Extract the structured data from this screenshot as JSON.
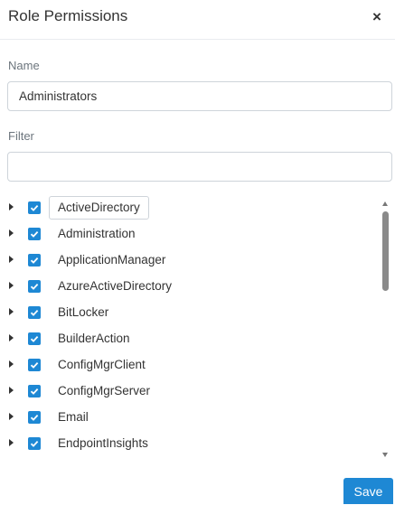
{
  "dialog": {
    "title": "Role Permissions",
    "close_icon": "close-icon",
    "close_glyph": "×"
  },
  "name_field": {
    "label": "Name",
    "value": "Administrators"
  },
  "filter_field": {
    "label": "Filter",
    "value": ""
  },
  "tree": {
    "items": [
      {
        "label": "ActiveDirectory",
        "checked": true,
        "focused": true
      },
      {
        "label": "Administration",
        "checked": true
      },
      {
        "label": "ApplicationManager",
        "checked": true
      },
      {
        "label": "AzureActiveDirectory",
        "checked": true
      },
      {
        "label": "BitLocker",
        "checked": true
      },
      {
        "label": "BuilderAction",
        "checked": true
      },
      {
        "label": "ConfigMgrClient",
        "checked": true
      },
      {
        "label": "ConfigMgrServer",
        "checked": true
      },
      {
        "label": "Email",
        "checked": true
      },
      {
        "label": "EndpointInsights",
        "checked": true
      }
    ]
  },
  "footer": {
    "save_label": "Save"
  },
  "colors": {
    "accent": "#1e88d4"
  }
}
